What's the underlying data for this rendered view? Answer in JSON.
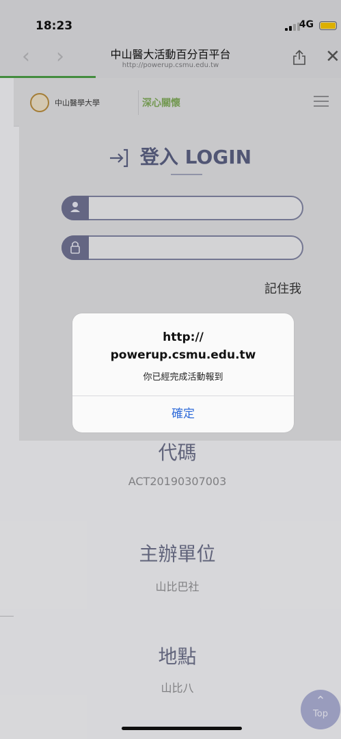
{
  "status_bar": {
    "time": "18:23",
    "network": "4G"
  },
  "browser": {
    "title": "中山醫大活動百分百平台",
    "url": "http://powerup.csmu.edu.tw",
    "back_icon": "chevron-left-icon",
    "forward_icon": "chevron-right-icon"
  },
  "site_header": {
    "logo_text": "中山醫學大學",
    "brand_text": "深心關懷"
  },
  "login": {
    "title": "登入 LOGIN",
    "username_value": "",
    "password_value": "",
    "remember_label": "記住我"
  },
  "sections": [
    {
      "title": "代碼",
      "value": "ACT20190307003"
    },
    {
      "title": "主辦單位",
      "value": "山比巴社"
    },
    {
      "title": "地點",
      "value": "山比八"
    }
  ],
  "top_button": {
    "label": "Top"
  },
  "alert": {
    "title_line1": "http://",
    "title_line2": "powerup.csmu.edu.tw",
    "message": "你已經完成活動報到",
    "confirm_label": "確定"
  },
  "colors": {
    "accent": "#5a5f80",
    "alert_button": "#2f6bd9",
    "progress": "#4a9a45"
  }
}
